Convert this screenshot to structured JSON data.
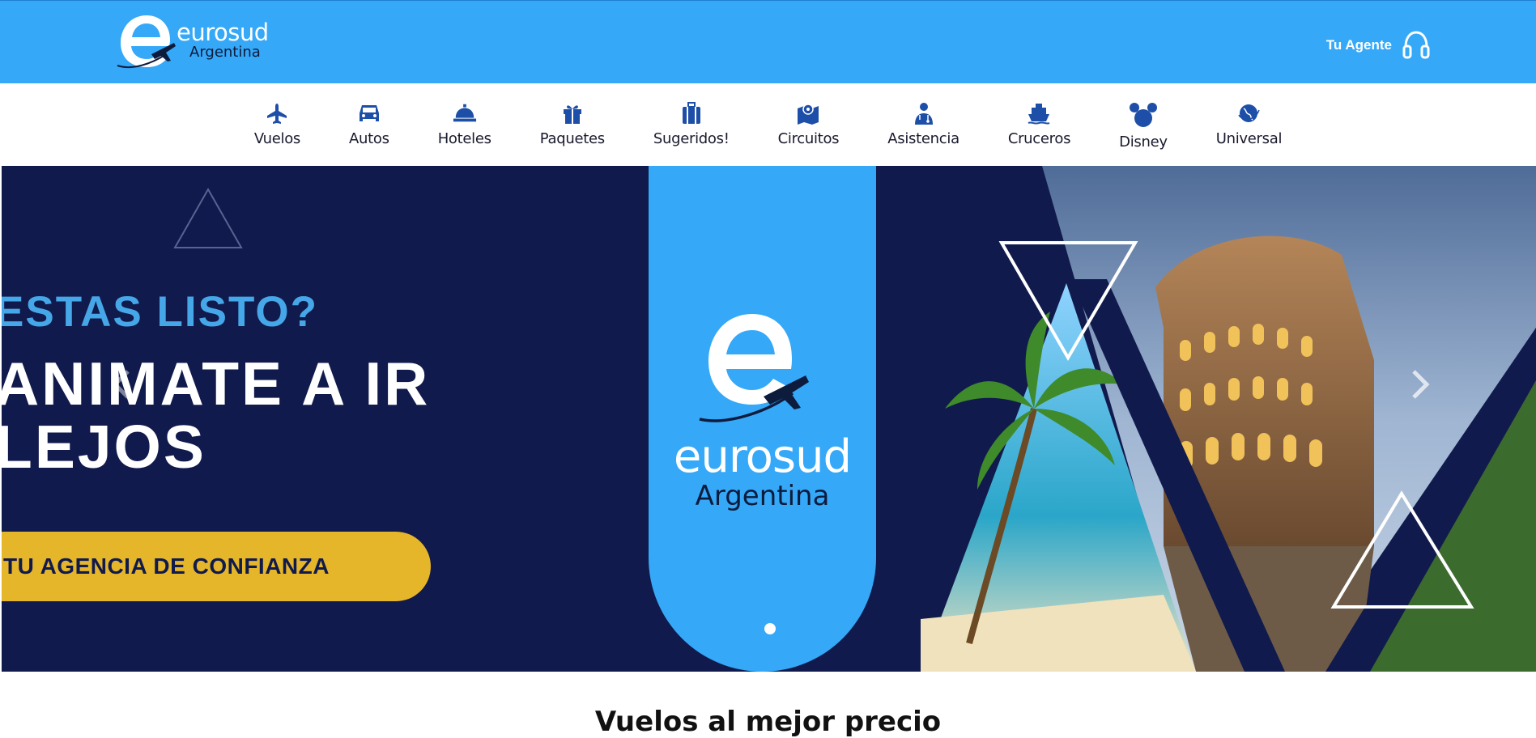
{
  "header": {
    "brand": "eurosud",
    "brand_sub": "Argentina",
    "agent_label": "Tu Agente"
  },
  "nav": {
    "items": [
      {
        "label": "Vuelos",
        "icon": "plane-icon"
      },
      {
        "label": "Autos",
        "icon": "car-icon"
      },
      {
        "label": "Hoteles",
        "icon": "bell-icon"
      },
      {
        "label": "Paquetes",
        "icon": "gift-icon"
      },
      {
        "label": "Sugeridos!",
        "icon": "suitcase-icon"
      },
      {
        "label": "Circuitos",
        "icon": "map-icon"
      },
      {
        "label": "Asistencia",
        "icon": "doctor-icon"
      },
      {
        "label": "Cruceros",
        "icon": "ship-icon"
      },
      {
        "label": "Disney",
        "icon": "mickey-icon"
      },
      {
        "label": "Universal",
        "icon": "globe-icon"
      }
    ]
  },
  "hero": {
    "question": "ESTAS LISTO?",
    "headline": "ANIMATE A IR LEJOS",
    "tagline": "TU AGENCIA DE CONFIANZA",
    "band_brand": "eurosud",
    "band_sub": "Argentina",
    "prev_icon": "chevron-left-icon",
    "next_icon": "chevron-right-icon"
  },
  "section": {
    "title": "Vuelos al mejor precio"
  },
  "colors": {
    "header_blue": "#35a8f8",
    "navy": "#111a4d",
    "nav_icon": "#1d4fa8",
    "yellow": "#e5b62a"
  }
}
